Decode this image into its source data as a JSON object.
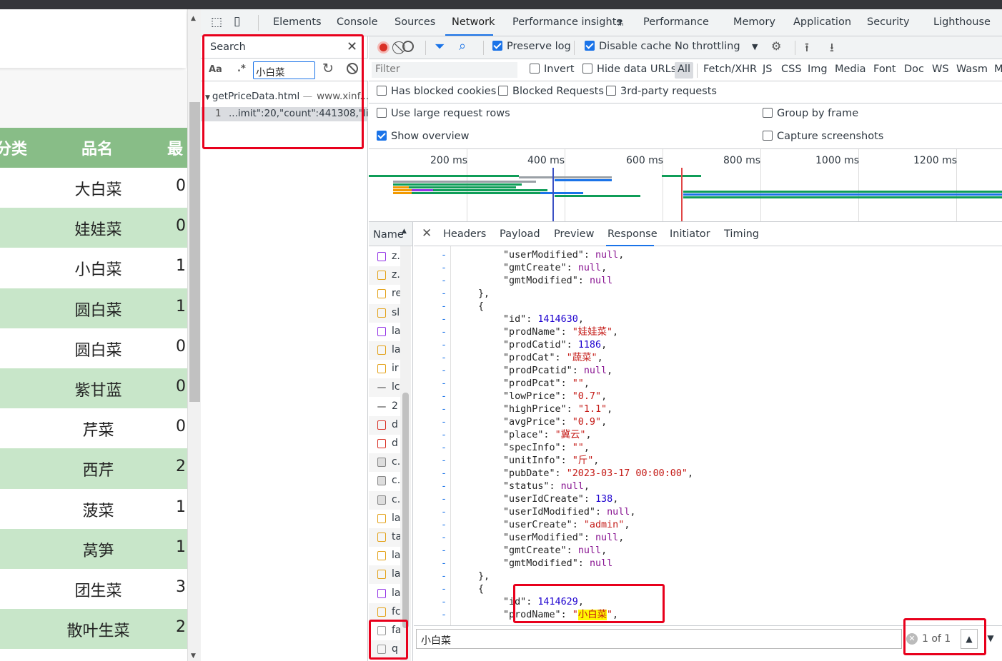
{
  "webpage": {
    "headers": [
      "分类",
      "品名",
      "最"
    ],
    "rows": [
      {
        "name": "大白菜",
        "num": "0"
      },
      {
        "name": "娃娃菜",
        "num": "0"
      },
      {
        "name": "小白菜",
        "num": "1"
      },
      {
        "name": "圆白菜",
        "num": "1"
      },
      {
        "name": "圆白菜",
        "num": "0"
      },
      {
        "name": "紫甘蓝",
        "num": "0"
      },
      {
        "name": "芹菜",
        "num": "0"
      },
      {
        "name": "西芹",
        "num": "2"
      },
      {
        "name": "菠菜",
        "num": "1"
      },
      {
        "name": "莴笋",
        "num": "1"
      },
      {
        "name": "团生菜",
        "num": "3"
      },
      {
        "name": "散叶生菜",
        "num": "2"
      }
    ],
    "colors": {
      "header": "#88bd87",
      "stripe": "#c8e6c9"
    }
  },
  "devtools": {
    "tabs": [
      "Elements",
      "Console",
      "Sources",
      "Network",
      "Performance insights",
      "Performance",
      "Memory",
      "Application",
      "Security",
      "Lighthouse"
    ],
    "active_tab": "Network",
    "search": {
      "title": "Search",
      "aa": "Aa",
      "regex": ".*",
      "query": "小白菜",
      "file": "getPriceData.html",
      "host": "www.xinf...",
      "line_no": "1",
      "line_text": "...imit\":20,\"count\":441308,\"li..."
    },
    "toolbar": {
      "preserve_log": "Preserve log",
      "disable_cache": "Disable cache",
      "throttling": "No throttling"
    },
    "filter": {
      "placeholder": "Filter",
      "invert": "Invert",
      "hide_data": "Hide data URLs",
      "types": [
        "All",
        "Fetch/XHR",
        "JS",
        "CSS",
        "Img",
        "Media",
        "Font",
        "Doc",
        "WS",
        "Wasm",
        "M"
      ]
    },
    "filter2": {
      "blocked_cookies": "Has blocked cookies",
      "blocked_requests": "Blocked Requests",
      "third_party": "3rd-party requests"
    },
    "options": {
      "large_rows": "Use large request rows",
      "group_frame": "Group by frame",
      "show_overview": "Show overview",
      "capture": "Capture screenshots"
    },
    "overview_labels": [
      "200 ms",
      "400 ms",
      "600 ms",
      "800 ms",
      "1000 ms",
      "1200 ms"
    ],
    "name_header": "Name",
    "name_items": [
      "z.",
      "z.",
      "re",
      "sl",
      "la",
      "la",
      "ir",
      "lc",
      "2",
      "d",
      "d",
      "c.",
      "c.",
      "c.",
      "la",
      "ta",
      "la",
      "la",
      "la",
      "fc",
      "fa",
      "q"
    ],
    "detail_tabs": [
      "Headers",
      "Payload",
      "Preview",
      "Response",
      "Initiator",
      "Timing"
    ],
    "active_detail": "Response",
    "find": {
      "query": "小白菜",
      "count": "1 of 1"
    },
    "code_lines": [
      {
        "indent": 8,
        "key": "\"userModified\"",
        "val": "null",
        "type": "k"
      },
      {
        "indent": 8,
        "key": "\"gmtCreate\"",
        "val": "null",
        "type": "k"
      },
      {
        "indent": 8,
        "key": "\"gmtModified\"",
        "val": "null",
        "type": "k",
        "last": true
      },
      {
        "indent": 4,
        "raw": "},"
      },
      {
        "indent": 4,
        "raw": "{"
      },
      {
        "indent": 8,
        "key": "\"id\"",
        "val": "1414630",
        "type": "n"
      },
      {
        "indent": 8,
        "key": "\"prodName\"",
        "val": "\"娃娃菜\"",
        "type": "s"
      },
      {
        "indent": 8,
        "key": "\"prodCatid\"",
        "val": "1186",
        "type": "n"
      },
      {
        "indent": 8,
        "key": "\"prodCat\"",
        "val": "\"蔬菜\"",
        "type": "s"
      },
      {
        "indent": 8,
        "key": "\"prodPcatid\"",
        "val": "null",
        "type": "k"
      },
      {
        "indent": 8,
        "key": "\"prodPcat\"",
        "val": "\"\"",
        "type": "s"
      },
      {
        "indent": 8,
        "key": "\"lowPrice\"",
        "val": "\"0.7\"",
        "type": "s"
      },
      {
        "indent": 8,
        "key": "\"highPrice\"",
        "val": "\"1.1\"",
        "type": "s"
      },
      {
        "indent": 8,
        "key": "\"avgPrice\"",
        "val": "\"0.9\"",
        "type": "s"
      },
      {
        "indent": 8,
        "key": "\"place\"",
        "val": "\"冀云\"",
        "type": "s"
      },
      {
        "indent": 8,
        "key": "\"specInfo\"",
        "val": "\"\"",
        "type": "s"
      },
      {
        "indent": 8,
        "key": "\"unitInfo\"",
        "val": "\"斤\"",
        "type": "s"
      },
      {
        "indent": 8,
        "key": "\"pubDate\"",
        "val": "\"2023-03-17 00:00:00\"",
        "type": "s"
      },
      {
        "indent": 8,
        "key": "\"status\"",
        "val": "null",
        "type": "k"
      },
      {
        "indent": 8,
        "key": "\"userIdCreate\"",
        "val": "138",
        "type": "n"
      },
      {
        "indent": 8,
        "key": "\"userIdModified\"",
        "val": "null",
        "type": "k"
      },
      {
        "indent": 8,
        "key": "\"userCreate\"",
        "val": "\"admin\"",
        "type": "s"
      },
      {
        "indent": 8,
        "key": "\"userModified\"",
        "val": "null",
        "type": "k"
      },
      {
        "indent": 8,
        "key": "\"gmtCreate\"",
        "val": "null",
        "type": "k"
      },
      {
        "indent": 8,
        "key": "\"gmtModified\"",
        "val": "null",
        "type": "k",
        "last": true
      },
      {
        "indent": 4,
        "raw": "},"
      },
      {
        "indent": 4,
        "raw": "{"
      },
      {
        "indent": 8,
        "key": "\"id\"",
        "val": "1414629",
        "type": "n"
      },
      {
        "indent": 8,
        "key": "\"prodName\"",
        "val": "\"小白菜\"",
        "type": "s",
        "highlight": "小白菜"
      }
    ]
  }
}
